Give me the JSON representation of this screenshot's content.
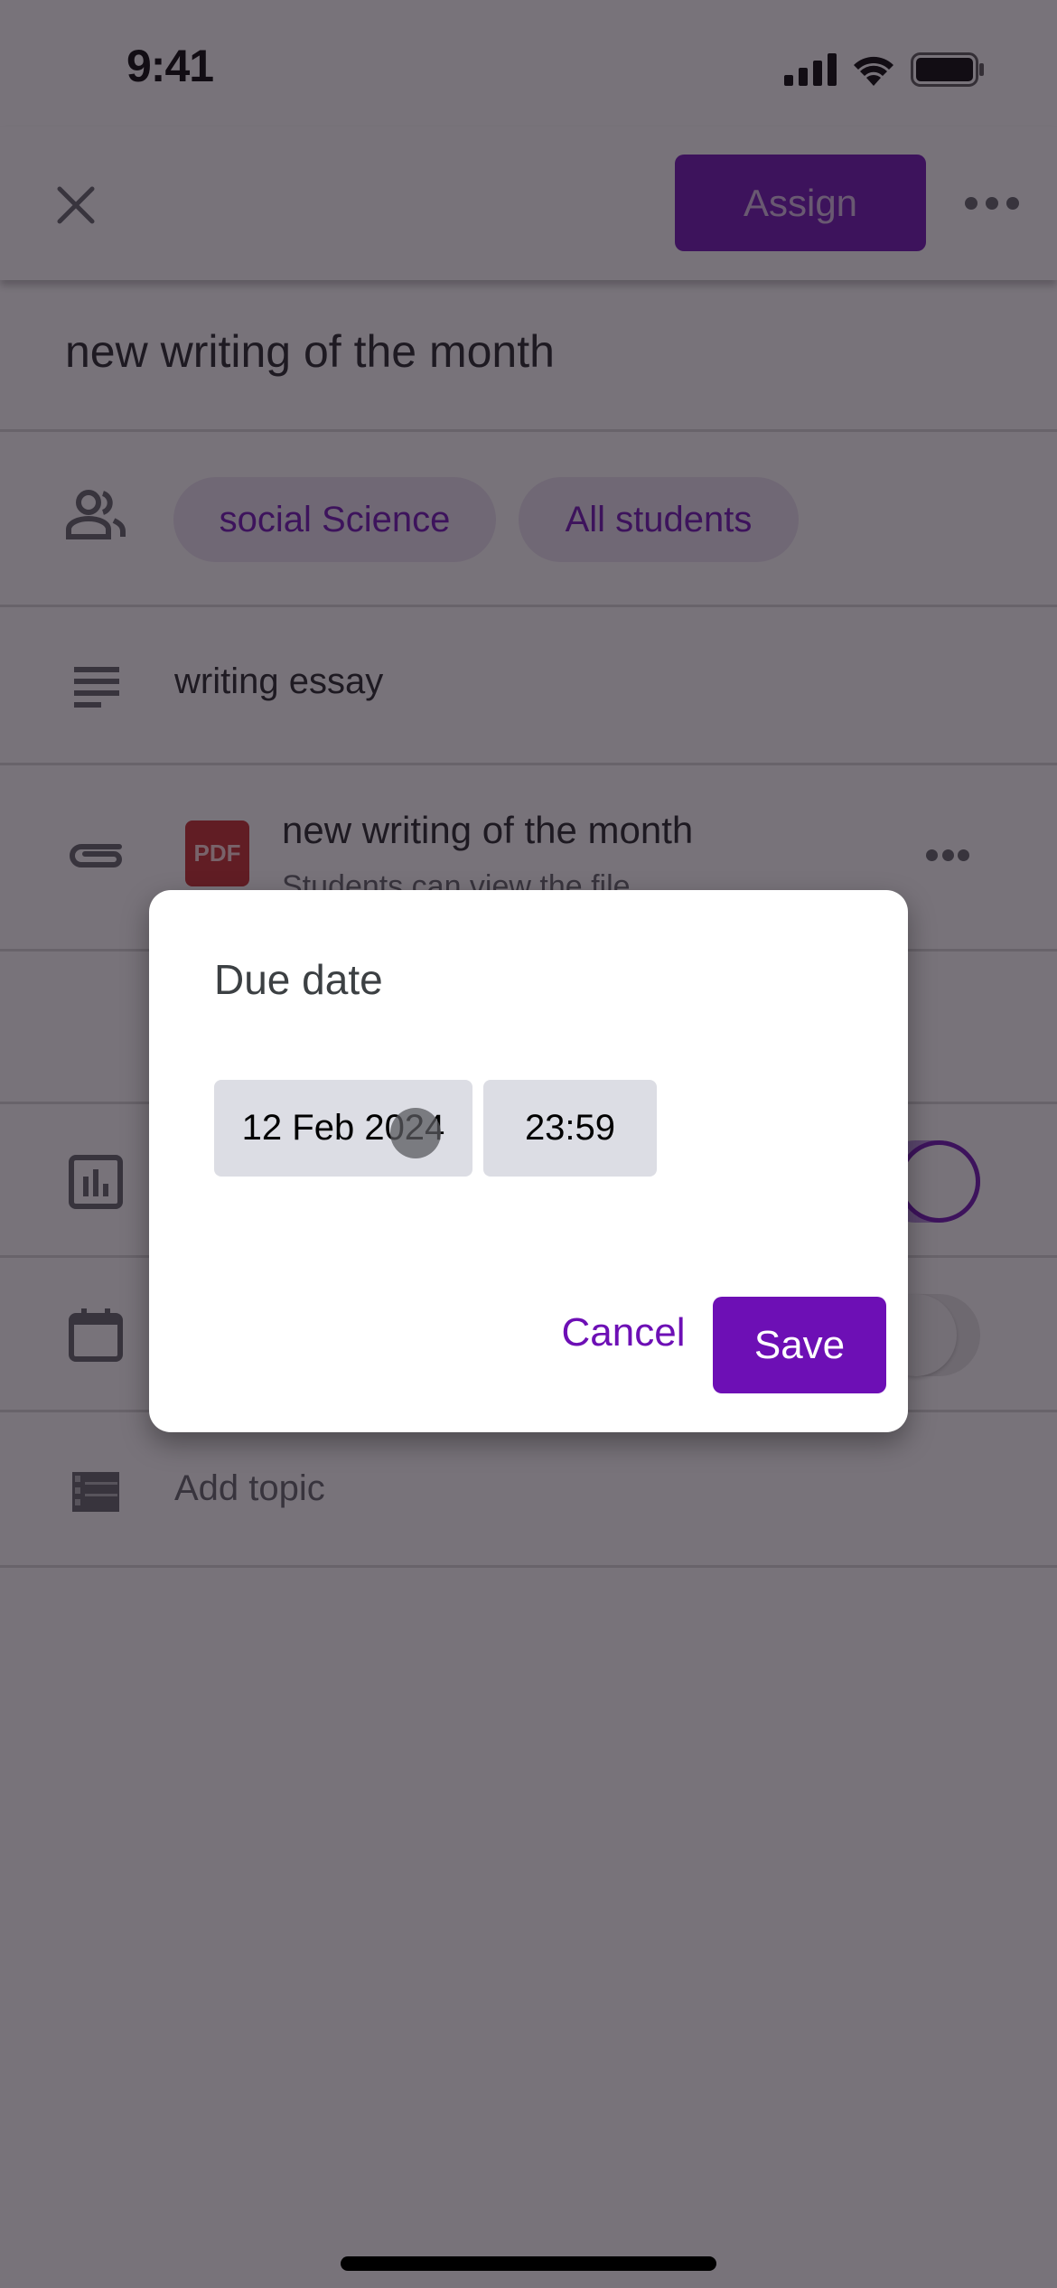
{
  "status_bar": {
    "time": "9:41"
  },
  "toolbar": {
    "close_icon": "close-icon",
    "assign_label": "Assign",
    "more_icon": "more-horizontal-icon"
  },
  "assignment": {
    "title": "new writing of the month",
    "class_chip": "social Science",
    "students_chip": "All students",
    "description": "writing essay",
    "attachment": {
      "type_badge": "PDF",
      "title": "new writing of the month",
      "subtitle": "Students can view the file"
    },
    "points_toggle_on": true,
    "due_toggle_on": false,
    "topic_placeholder": "Add topic"
  },
  "dialog": {
    "title": "Due date",
    "date_value": "12 Feb 2024",
    "time_value": "23:59",
    "cancel_label": "Cancel",
    "save_label": "Save"
  },
  "colors": {
    "accent": "#6d0fb5",
    "chip_bg": "#ebe3f2",
    "pdf_red": "#c62828",
    "field_bg": "#dcdde4"
  }
}
